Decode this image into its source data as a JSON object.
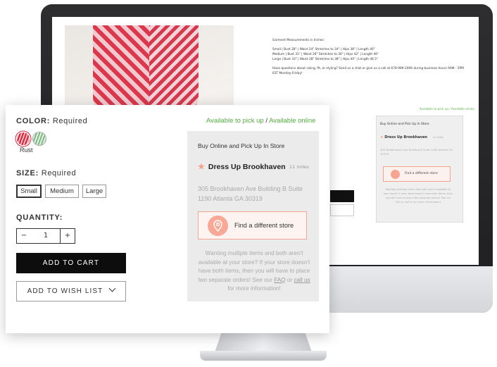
{
  "screen": {
    "measurements_heading": "Garment Measurements in Inches:",
    "measure_small": "Small | Bust 28\" | Waist 24\" Stretches to 34\" | Hips 38\" | Length 46\"",
    "measure_medium": "Medium | Bust 31\" | Waist 26\" Stretches to 36\" | Hips 42\" | Length 46\"",
    "measure_large": "Large | Bust 33\" | Waist 28\" Stretches to 38\" | Hips 44\" | Length 46.5\"",
    "questions": "Have questions about sizing, fit, or styling? Send us a chat or give us a call at 678-989-2006 during business hours 9AM - 5PM EST Monday-Friday!",
    "mini_available": "Available to pick up / Available online",
    "mini_pickup_title": "Buy Online and Pick Up In Store",
    "mini_store": "Dress Up Brookhaven",
    "mini_miles": "11 miles",
    "mini_address": "305 Brookhaven Ave Building B Suite 1190 Atlanta GA 30319",
    "mini_find": "Find a different store",
    "mini_note": "Wanting multiple items and both aren't available at your store? If your store doesn't have both items, then you will have to place two separate orders! See our FAQ or call us for more information!"
  },
  "product": {
    "color_label": "COLOR:",
    "required": "Required",
    "available_pickup": "Available to pick up",
    "separator": " / ",
    "available_online": "Available online",
    "selected_color": "Rust",
    "size_label": "SIZE:",
    "sizes": [
      "Small",
      "Medium",
      "Large"
    ],
    "quantity_label": "QUANTITY:",
    "qty_minus": "−",
    "qty_value": "1",
    "qty_plus": "+",
    "add_to_cart": "ADD TO CART",
    "add_to_wish_list": "ADD TO WISH LIST"
  },
  "pickup": {
    "title": "Buy Online and Pick Up In Store",
    "store_name": "Dress Up Brookhaven",
    "miles": "11 miles",
    "address": "305 Brookhaven Ave Building B Suite 1190 Atlanta GA 30319",
    "find_store": "Find a different store",
    "note_text": "Wanting multiple items and both aren't available at your store? If your store doesn't have both items, then you will have to place two separate orders! See our",
    "faq": "FAQ",
    "or": "or",
    "call_us": "call us",
    "note_end": "for more information!"
  },
  "colors": {
    "accent_green": "#55a843",
    "accent_coral": "#f4a592",
    "cart_bg": "#0d0d0d"
  }
}
